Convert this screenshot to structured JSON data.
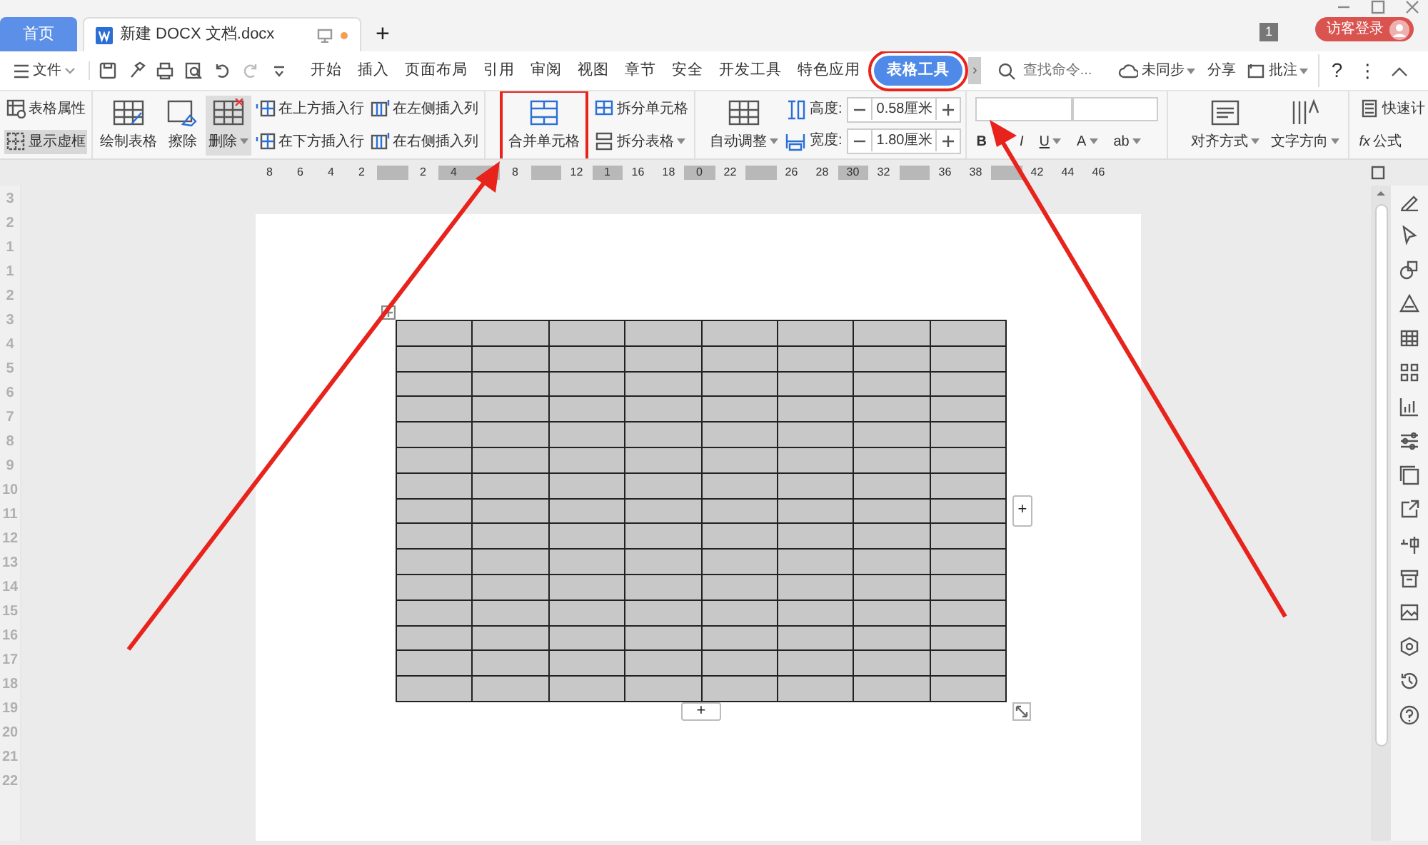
{
  "title_bar": {
    "tabs": [
      {
        "label": "首页",
        "kind": "home",
        "selected": false
      },
      {
        "label": "新建 DOCX 文档.docx",
        "kind": "doc",
        "selected": true,
        "unsaved": true
      }
    ],
    "new_tab": "+",
    "badge": "1",
    "login": "访客登录"
  },
  "menu_bar": {
    "file": "文件",
    "tabs": [
      {
        "label": "开始",
        "selected": false
      },
      {
        "label": "插入",
        "selected": false
      },
      {
        "label": "页面布局",
        "selected": false
      },
      {
        "label": "引用",
        "selected": false
      },
      {
        "label": "审阅",
        "selected": false
      },
      {
        "label": "视图",
        "selected": false
      },
      {
        "label": "章节",
        "selected": false
      },
      {
        "label": "安全",
        "selected": false
      },
      {
        "label": "开发工具",
        "selected": false
      },
      {
        "label": "特色应用",
        "selected": false
      },
      {
        "label": "表格工具",
        "selected": true,
        "highlighted": true
      }
    ],
    "more": "›",
    "search": {
      "placeholder": "查找命令..."
    },
    "sync": "未同步",
    "share": "分享",
    "comment": "批注",
    "help": "?",
    "more_menu": "⋮"
  },
  "ribbon": {
    "properties": "表格属性",
    "gridlines": {
      "label": "显示虚框",
      "on": true
    },
    "draw": "绘制表格",
    "erase": "擦除",
    "delete": "删除",
    "insert_rows": [
      "在上方插入行",
      "在下方插入行"
    ],
    "insert_cols": [
      "在左侧插入列",
      "在右侧插入列"
    ],
    "merge": {
      "label": "合并单元格",
      "highlighted": true
    },
    "split_cell": "拆分单元格",
    "split_table": "拆分表格",
    "autofit": "自动调整",
    "height": {
      "label": "高度:",
      "value": "0.58厘米"
    },
    "width": {
      "label": "宽度:",
      "value": "1.80厘米"
    },
    "font_buttons": [
      "B",
      "I",
      "U",
      "A",
      "ab"
    ],
    "align": "对齐方式",
    "direction": "文字方向",
    "quick_calc": "快速计",
    "formula_icon": "fx",
    "formula": "公式"
  },
  "ruler": [
    {
      "label": "8"
    },
    {
      "label": "6"
    },
    {
      "label": "4"
    },
    {
      "label": "2"
    },
    {
      "marker": true
    },
    {
      "label": "2"
    },
    {
      "label": "4",
      "marker": true
    },
    {
      "marker": true
    },
    {
      "label": "8"
    },
    {
      "marker": true
    },
    {
      "label": "12"
    },
    {
      "label": "1",
      "marker": true
    },
    {
      "label": "16"
    },
    {
      "label": "18"
    },
    {
      "label": "0",
      "marker": true
    },
    {
      "label": "22"
    },
    {
      "marker": true
    },
    {
      "label": "26"
    },
    {
      "label": "28"
    },
    {
      "label": "30",
      "marker": true
    },
    {
      "label": "32"
    },
    {
      "marker": true
    },
    {
      "label": "36"
    },
    {
      "label": "38"
    },
    {
      "marker": true
    },
    {
      "label": "42"
    },
    {
      "label": "44"
    },
    {
      "label": "46"
    }
  ],
  "vertical_ruler": [
    "3",
    "2",
    "1",
    "1",
    "2",
    "3",
    "4",
    "5",
    "6",
    "7",
    "8",
    "9",
    "10",
    "11",
    "12",
    "13",
    "14",
    "15",
    "16",
    "17",
    "18",
    "19",
    "20",
    "21",
    "22"
  ],
  "table": {
    "shaded": true,
    "add_column": "+",
    "add_row": "+"
  }
}
